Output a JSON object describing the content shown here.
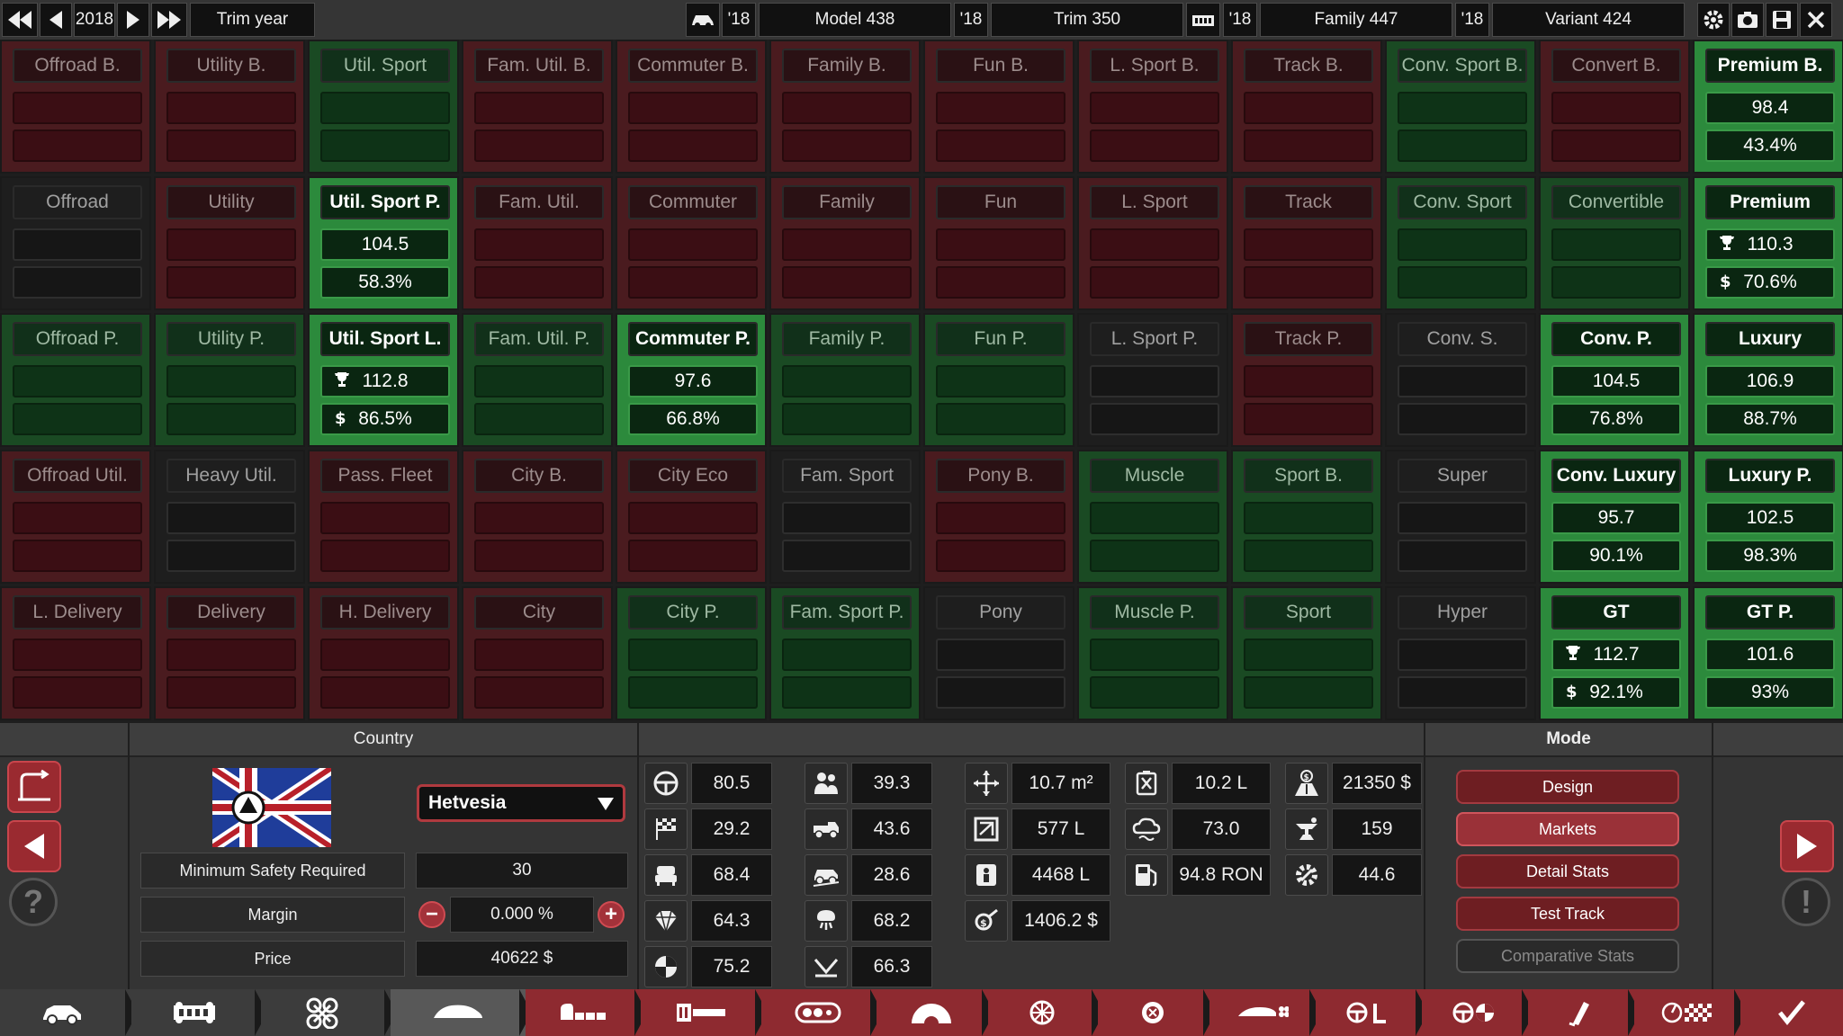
{
  "topbar": {
    "year": "2018",
    "trim_year_label": "Trim year",
    "model_year": "'18",
    "model_label": "Model 438",
    "trim_year": "'18",
    "trim_label": "Trim 350",
    "family_year": "'18",
    "family_label": "Family 447",
    "variant_year": "'18",
    "variant_label": "Variant 424"
  },
  "grid": [
    [
      {
        "t": "Offroad B.",
        "c": "red"
      },
      {
        "t": "Utility B.",
        "c": "red"
      },
      {
        "t": "Util. Sport",
        "c": "green"
      },
      {
        "t": "Fam. Util. B.",
        "c": "red"
      },
      {
        "t": "Commuter B.",
        "c": "red"
      },
      {
        "t": "Family B.",
        "c": "red"
      },
      {
        "t": "Fun B.",
        "c": "red"
      },
      {
        "t": "L. Sport B.",
        "c": "red"
      },
      {
        "t": "Track B.",
        "c": "red"
      },
      {
        "t": "Conv. Sport B.",
        "c": "green"
      },
      {
        "t": "Convert B.",
        "c": "red"
      },
      {
        "t": "Premium B.",
        "c": "bgreen",
        "v1": "98.4",
        "v2": "43.4%"
      }
    ],
    [
      {
        "t": "Offroad",
        "c": "dark"
      },
      {
        "t": "Utility",
        "c": "red"
      },
      {
        "t": "Util. Sport P.",
        "c": "bgreen",
        "v1": "104.5",
        "v2": "58.3%"
      },
      {
        "t": "Fam. Util.",
        "c": "red"
      },
      {
        "t": "Commuter",
        "c": "red"
      },
      {
        "t": "Family",
        "c": "red"
      },
      {
        "t": "Fun",
        "c": "red"
      },
      {
        "t": "L. Sport",
        "c": "red"
      },
      {
        "t": "Track",
        "c": "red"
      },
      {
        "t": "Conv. Sport",
        "c": "green"
      },
      {
        "t": "Convertible",
        "c": "green"
      },
      {
        "t": "Premium",
        "c": "bgreen",
        "v1": "110.3",
        "v2": "70.6%",
        "i1": "trophy",
        "i2": "$"
      }
    ],
    [
      {
        "t": "Offroad P.",
        "c": "green"
      },
      {
        "t": "Utility P.",
        "c": "green"
      },
      {
        "t": "Util. Sport L.",
        "c": "bgreen",
        "v1": "112.8",
        "v2": "86.5%",
        "i1": "trophy",
        "i2": "$"
      },
      {
        "t": "Fam. Util. P.",
        "c": "green"
      },
      {
        "t": "Commuter P.",
        "c": "bgreen",
        "v1": "97.6",
        "v2": "66.8%"
      },
      {
        "t": "Family P.",
        "c": "green"
      },
      {
        "t": "Fun P.",
        "c": "green"
      },
      {
        "t": "L. Sport P.",
        "c": "dark"
      },
      {
        "t": "Track P.",
        "c": "red"
      },
      {
        "t": "Conv. S.",
        "c": "dark"
      },
      {
        "t": "Conv. P.",
        "c": "bgreen",
        "v1": "104.5",
        "v2": "76.8%"
      },
      {
        "t": "Luxury",
        "c": "bgreen",
        "v1": "106.9",
        "v2": "88.7%"
      }
    ],
    [
      {
        "t": "Offroad Util.",
        "c": "red"
      },
      {
        "t": "Heavy Util.",
        "c": "dark"
      },
      {
        "t": "Pass. Fleet",
        "c": "red"
      },
      {
        "t": "City B.",
        "c": "red"
      },
      {
        "t": "City Eco",
        "c": "red"
      },
      {
        "t": "Fam. Sport",
        "c": "dark"
      },
      {
        "t": "Pony B.",
        "c": "red"
      },
      {
        "t": "Muscle",
        "c": "green"
      },
      {
        "t": "Sport B.",
        "c": "green"
      },
      {
        "t": "Super",
        "c": "dark"
      },
      {
        "t": "Conv. Luxury",
        "c": "bgreen",
        "v1": "95.7",
        "v2": "90.1%"
      },
      {
        "t": "Luxury P.",
        "c": "bgreen",
        "v1": "102.5",
        "v2": "98.3%"
      }
    ],
    [
      {
        "t": "L. Delivery",
        "c": "red"
      },
      {
        "t": "Delivery",
        "c": "red"
      },
      {
        "t": "H. Delivery",
        "c": "red"
      },
      {
        "t": "City",
        "c": "red"
      },
      {
        "t": "City P.",
        "c": "green"
      },
      {
        "t": "Fam. Sport P.",
        "c": "green"
      },
      {
        "t": "Pony",
        "c": "dark"
      },
      {
        "t": "Muscle P.",
        "c": "green"
      },
      {
        "t": "Sport",
        "c": "green"
      },
      {
        "t": "Hyper",
        "c": "dark"
      },
      {
        "t": "GT",
        "c": "bgreen",
        "v1": "112.7",
        "v2": "92.1%",
        "i1": "trophy",
        "i2": "$"
      },
      {
        "t": "GT P.",
        "c": "bgreen",
        "v1": "101.6",
        "v2": "93%"
      }
    ]
  ],
  "country": {
    "header": "Country",
    "selected": "Hetvesia",
    "min_safety_label": "Minimum Safety Required",
    "min_safety_value": "30",
    "margin_label": "Margin",
    "margin_value": "0.000 %",
    "price_label": "Price",
    "price_value": "40622 $"
  },
  "stats": {
    "col1": [
      "80.5",
      "29.2",
      "68.4",
      "64.3",
      "75.2"
    ],
    "col2": [
      "39.3",
      "43.6",
      "28.6",
      "68.2",
      "66.3"
    ],
    "col3": [
      "10.7 m²",
      "577 L",
      "4468 L",
      "1406.2 $"
    ],
    "col4": [
      "10.2 L",
      "73.0",
      "94.8 RON"
    ],
    "col5": [
      "21350 $",
      "159",
      "44.6"
    ]
  },
  "mode": {
    "header": "Mode",
    "buttons": [
      "Design",
      "Markets",
      "Detail Stats",
      "Test Track",
      "Comparative Stats"
    ]
  },
  "colors": {
    "accent_red": "#9a3138",
    "good_green": "#2c8a3c",
    "bad_red": "#4a1b1f"
  }
}
